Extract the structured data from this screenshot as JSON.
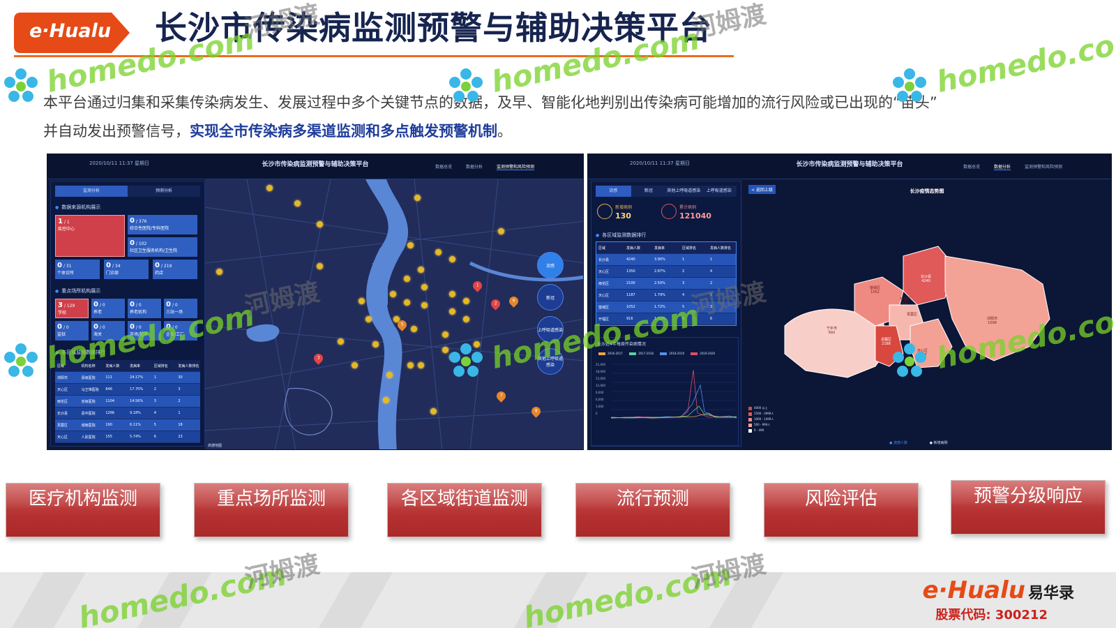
{
  "header": {
    "logo": "e·Hualu",
    "title": "长沙市传染病监测预警与辅助决策平台"
  },
  "intro": {
    "line1": "本平台通过归集和采集传染病发生、发展过程中多个关键节点的数据，及早、智能化地判别出传染病可能增加的流行风险或已出现的“苗头”",
    "line2_prefix": "并自动发出预警信号，",
    "line2_bold": "实现全市传染病多渠道监测和多点触发预警机制",
    "line2_suffix": "。"
  },
  "left_panel": {
    "date": "2020/10/11 11:37 星期日",
    "title": "长沙市传染病监测预警与辅助决策平台",
    "nav": [
      "数据总览",
      "数据分析",
      "监测预警和风险预测"
    ],
    "tabs": [
      "监测分析",
      "预测分析"
    ],
    "sec1": "数据来源机构展示",
    "sec2": "重点场所机构展示",
    "sec3": "各区域监测数据排行",
    "tiles": [
      {
        "n": "1",
        "d": "/ 1",
        "t": "疾控中心"
      },
      {
        "n": "0",
        "d": "/ 376",
        "t": "综合性医院/专科医院"
      },
      {
        "n": "0",
        "d": "/ 102",
        "t": "社区卫生服务机构/卫生院"
      },
      {
        "n": "0",
        "d": "/ 31",
        "t": "个体诊所"
      },
      {
        "n": "0",
        "d": "/ 34",
        "t": "门诊部"
      },
      {
        "n": "0",
        "d": "/ 219",
        "t": "药店"
      }
    ],
    "tiles2": [
      {
        "n": "3",
        "d": "/ 129",
        "t": "学校"
      },
      {
        "n": "0",
        "d": "/ 0",
        "t": "养老"
      },
      {
        "n": "0",
        "d": "/ 0",
        "t": "养老机构"
      },
      {
        "n": "0",
        "d": "/ 0",
        "t": "三站一场"
      },
      {
        "n": "0",
        "d": "/ 0",
        "t": "监狱"
      },
      {
        "n": "0",
        "d": "/ 0",
        "t": "海关"
      },
      {
        "n": "0",
        "d": "/ 0",
        "t": "市场/超市"
      },
      {
        "n": "0",
        "d": "/ 0",
        "t": "企业/工厂"
      }
    ],
    "table": {
      "headers": [
        "区域",
        "机构名称",
        "发病人数",
        "发病率",
        "区域排名",
        "发病人数排名"
      ],
      "rows": [
        [
          "浏阳市",
          "县级医院",
          "111",
          "24.17%",
          "1",
          "30"
        ],
        [
          "天心区",
          "马王堆医院",
          "646",
          "17.70%",
          "2",
          "3"
        ],
        [
          "雨花区",
          "省级医院",
          "1104",
          "14.56%",
          "3",
          "2"
        ],
        [
          "长沙县",
          "县中医院",
          "1266",
          "9.18%",
          "4",
          "1"
        ],
        [
          "芙蓉区",
          "城南医院",
          "190",
          "6.11%",
          "5",
          "18"
        ],
        [
          "天心区",
          "人民医院",
          "155",
          "5.74%",
          "6",
          "23"
        ]
      ]
    },
    "map_buttons": [
      "流感",
      "新冠",
      "上呼吸道感染",
      "其他上呼吸道感染"
    ],
    "pins": [
      "5",
      "3",
      "7",
      "8",
      "2",
      "6",
      "1"
    ],
    "map_footer": "高德地图"
  },
  "right_panel": {
    "date": "2020/10/11 11:37 星期日",
    "title": "长沙市传染病监测预警与辅助决策平台",
    "nav": [
      "数据总览",
      "数据分析",
      "监测预警和风险预测"
    ],
    "tabs": [
      "流感",
      "新冠",
      "其他上呼吸道感染",
      "上呼吸道感染"
    ],
    "back": "< 返回上级",
    "stat1_label": "新增病例",
    "stat1_value": "130",
    "stat2_label": "累计病例",
    "stat2_value": "121040",
    "sec1": "各区域监测数据排行",
    "table": {
      "headers": [
        "区域",
        "发病人数",
        "发病率",
        "区域排名",
        "发病人数排名"
      ],
      "rows": [
        [
          "长沙县",
          "4240",
          "3.90%",
          "1",
          "1"
        ],
        [
          "天心区",
          "1350",
          "2.87%",
          "2",
          "4"
        ],
        [
          "雨花区",
          "2100",
          "2.50%",
          "3",
          "2"
        ],
        [
          "天心区",
          "1187",
          "1.79%",
          "4",
          "5"
        ],
        [
          "望城区",
          "1052",
          "1.72%",
          "5",
          "3"
        ],
        [
          "开福区",
          "916",
          "1.71%",
          "6",
          "6"
        ]
      ]
    },
    "chart_title": "长沙近4年每周传染病情况",
    "chart_legend": [
      "2016-2017",
      "2017-2018",
      "2018-2019",
      "2019-2020"
    ],
    "chart_y_ticks": [
      "21,000",
      "18,000",
      "15,000",
      "12,000",
      "9,000",
      "6,000",
      "3,000",
      "0"
    ],
    "map_title": "长沙疫情态势图",
    "regions": [
      {
        "name": "宁乡市",
        "value": "692"
      },
      {
        "name": "望城区",
        "value": "1052"
      },
      {
        "name": "开福区",
        "value": "916"
      },
      {
        "name": "长沙县",
        "value": "4240"
      },
      {
        "name": "浏阳市",
        "value": "1008"
      },
      {
        "name": "芙蓉区",
        "value": ""
      },
      {
        "name": "岳麓区",
        "value": "2188"
      },
      {
        "name": "天心区",
        "value": "1187"
      }
    ],
    "map_legend": [
      "4000 以上",
      "1500 - 3999人",
      "1000 - 1499人",
      "500 - 999人",
      "0 - 499"
    ],
    "map_bottom": [
      "流感人数",
      "新增病例"
    ]
  },
  "buttons": [
    "医疗机构监测",
    "重点场所监测",
    "各区域街道监测",
    "流行预测",
    "风险评估",
    "预警分级响应"
  ],
  "footer": {
    "logo": "e·Hualu",
    "logo_cn": "易华录",
    "stock": "股票代码: 300212"
  },
  "watermarks": {
    "latin": "homedo.com",
    "cn": "河姆渡"
  },
  "colors": {
    "accent_orange": "#ec6a1c",
    "title_navy": "#16244f",
    "button_red": "#b53131"
  }
}
